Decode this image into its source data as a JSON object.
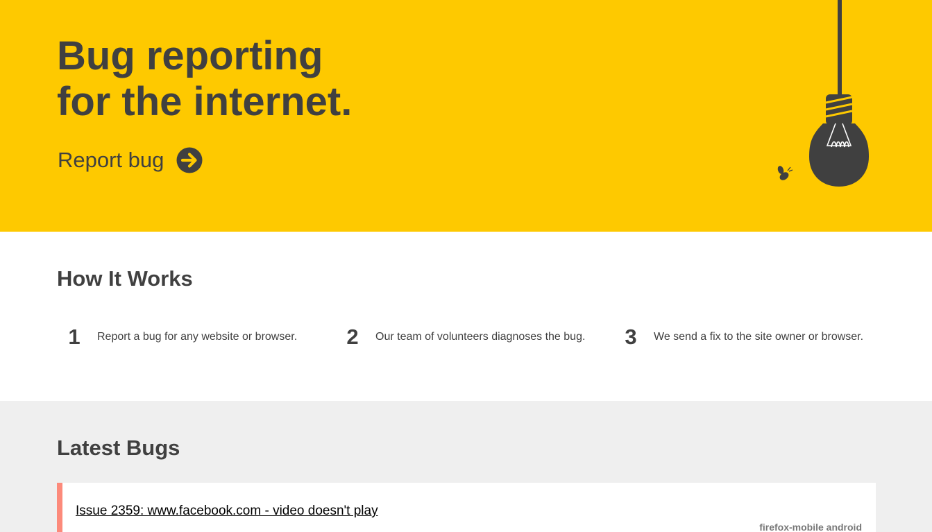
{
  "hero": {
    "title_line1": "Bug reporting",
    "title_line2": "for the internet.",
    "report_label": "Report bug",
    "bg_color": "#fec900",
    "icons": [
      "arrow-circle-icon",
      "light-bulb-icon",
      "bee-icon"
    ]
  },
  "how": {
    "title": "How It Works",
    "steps": [
      {
        "num": "1",
        "text": "Report a bug for any website or browser."
      },
      {
        "num": "2",
        "text": "Our team of volunteers diagnoses the bug."
      },
      {
        "num": "3",
        "text": "We send a fix to the site owner or browser."
      }
    ]
  },
  "latest": {
    "title": "Latest Bugs",
    "issues": [
      {
        "title": "Issue 2359: www.facebook.com - video doesn't play",
        "tags": "firefox-mobile android",
        "accent": "#fc8a7b"
      }
    ]
  }
}
